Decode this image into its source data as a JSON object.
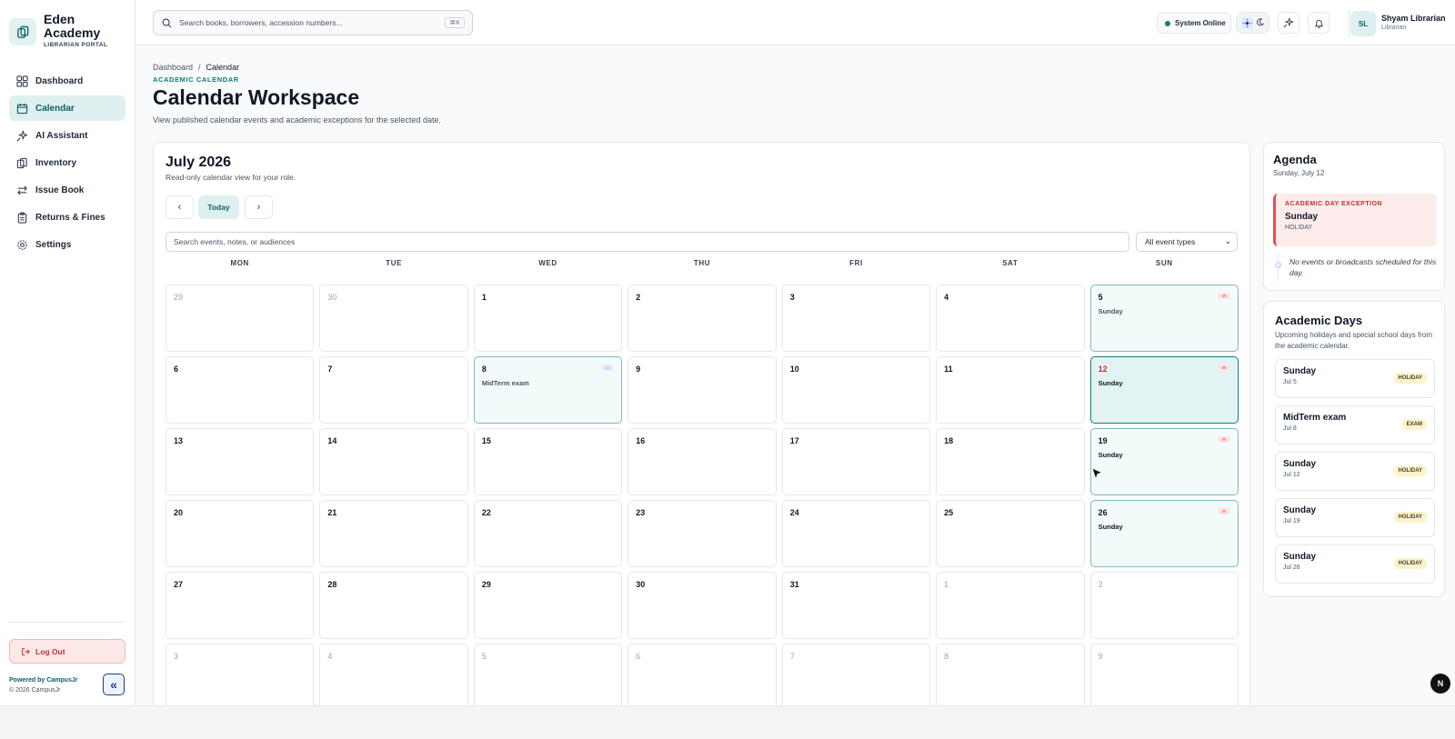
{
  "brand": {
    "name": "Eden Academy",
    "subtitle": "LIBRARIAN PORTAL"
  },
  "sidebar": {
    "items": [
      {
        "label": "Dashboard",
        "icon": "grid-icon"
      },
      {
        "label": "Calendar",
        "icon": "calendar-icon",
        "active": true
      },
      {
        "label": "AI Assistant",
        "icon": "sparkles-icon"
      },
      {
        "label": "Inventory",
        "icon": "books-icon"
      },
      {
        "label": "Issue Book",
        "icon": "swap-icon"
      },
      {
        "label": "Returns & Fines",
        "icon": "clipboard-icon"
      },
      {
        "label": "Settings",
        "icon": "gear-icon"
      }
    ],
    "logout_label": "Log Out",
    "powered_by": "Powered by CampusJr",
    "copyright": "© 2026 CampusJr"
  },
  "topbar": {
    "search_placeholder": "Search books, borrowers, accession numbers...",
    "shortcut": "⌘K",
    "status": "System Online",
    "user": {
      "initials": "SL",
      "name": "Shyam Librarian",
      "role": "Librarian"
    }
  },
  "header": {
    "breadcrumb": [
      "Dashboard",
      "Calendar"
    ],
    "eyebrow": "ACADEMIC CALENDAR",
    "title": "Calendar Workspace",
    "description": "View published calendar events and academic exceptions for the selected date."
  },
  "calendar": {
    "month_title": "July 2026",
    "subtitle": "Read-only calendar view for your role.",
    "today_label": "Today",
    "search_placeholder": "Search events, notes, or audiences",
    "filter_value": "All event types",
    "weekdays": [
      "MON",
      "TUE",
      "WED",
      "THU",
      "FRI",
      "SAT",
      "SUN"
    ],
    "days": [
      {
        "n": "29",
        "muted": true
      },
      {
        "n": "30",
        "muted": true
      },
      {
        "n": "1"
      },
      {
        "n": "2"
      },
      {
        "n": "3"
      },
      {
        "n": "4"
      },
      {
        "n": "5",
        "kind": "sunday",
        "event": "Sunday",
        "dim": true
      },
      {
        "n": "6"
      },
      {
        "n": "7"
      },
      {
        "n": "8",
        "kind": "exam",
        "event": "MidTerm exam"
      },
      {
        "n": "9"
      },
      {
        "n": "10"
      },
      {
        "n": "11"
      },
      {
        "n": "12",
        "kind": "selected",
        "event": "Sunday"
      },
      {
        "n": "13"
      },
      {
        "n": "14"
      },
      {
        "n": "15"
      },
      {
        "n": "16"
      },
      {
        "n": "17"
      },
      {
        "n": "18"
      },
      {
        "n": "19",
        "kind": "sunday",
        "event": "Sunday"
      },
      {
        "n": "20"
      },
      {
        "n": "21"
      },
      {
        "n": "22"
      },
      {
        "n": "23"
      },
      {
        "n": "24"
      },
      {
        "n": "25"
      },
      {
        "n": "26",
        "kind": "sunday",
        "event": "Sunday"
      },
      {
        "n": "27"
      },
      {
        "n": "28"
      },
      {
        "n": "29"
      },
      {
        "n": "30"
      },
      {
        "n": "31"
      },
      {
        "n": "1",
        "muted": true
      },
      {
        "n": "2",
        "muted": true
      },
      {
        "n": "3",
        "muted": true
      },
      {
        "n": "4",
        "muted": true
      },
      {
        "n": "5",
        "muted": true
      },
      {
        "n": "6",
        "muted": true
      },
      {
        "n": "7",
        "muted": true
      },
      {
        "n": "8",
        "muted": true
      },
      {
        "n": "9",
        "muted": true
      }
    ]
  },
  "agenda": {
    "title": "Agenda",
    "date": "Sunday, July 12",
    "exception_label": "ACADEMIC DAY EXCEPTION",
    "exception_title": "Sunday",
    "exception_type": "HOLIDAY",
    "empty_message": "No events or broadcasts scheduled for this day."
  },
  "academic_days": {
    "title": "Academic Days",
    "description": "Upcoming holidays and special school days from the academic calendar.",
    "items": [
      {
        "name": "Sunday",
        "date": "Jul 5",
        "badge": "HOLIDAY"
      },
      {
        "name": "MidTerm exam",
        "date": "Jul 8",
        "badge": "EXAM"
      },
      {
        "name": "Sunday",
        "date": "Jul 12",
        "badge": "HOLIDAY"
      },
      {
        "name": "Sunday",
        "date": "Jul 19",
        "badge": "HOLIDAY"
      },
      {
        "name": "Sunday",
        "date": "Jul 26",
        "badge": "HOLIDAY"
      }
    ]
  },
  "floating_badge": "N",
  "colors": {
    "accent": "#0f7b7b",
    "danger": "#c53030",
    "selected_bg": "#e3f3f4"
  }
}
